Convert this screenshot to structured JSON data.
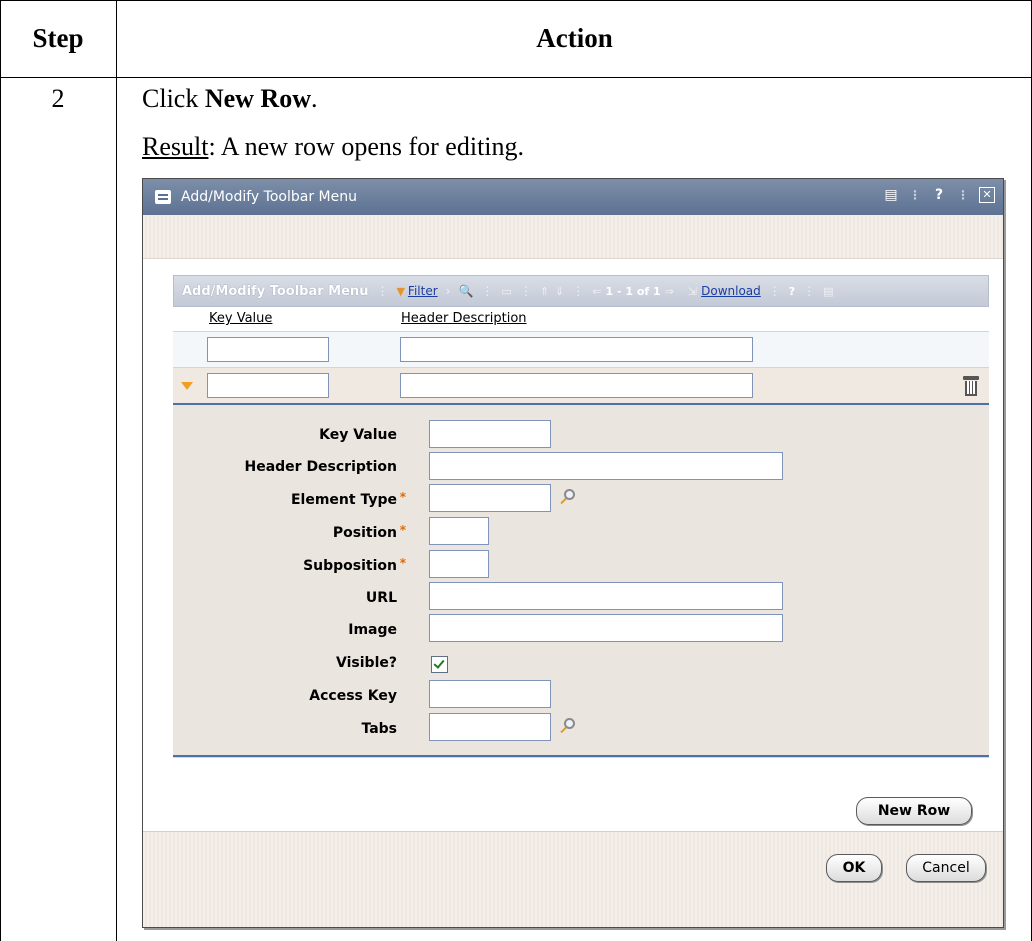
{
  "doc": {
    "header_step": "Step",
    "header_action": "Action",
    "step_number": "2",
    "instruction_prefix": "Click ",
    "instruction_bold": "New Row",
    "instruction_suffix": ".",
    "result_label": "Result",
    "result_text": ": A new row opens for editing."
  },
  "dialog": {
    "title": "Add/Modify Toolbar Menu",
    "title_controls": [
      "window-icon",
      "help-icon",
      "close-icon"
    ],
    "help_glyph": "?",
    "grid": {
      "title": "Add/Modify Toolbar Menu",
      "filter_label": "Filter",
      "pagination": "1 - 1 of 1",
      "download_label": "Download",
      "help_glyph": "?",
      "columns": [
        "Key Value",
        "Header Description"
      ],
      "rows": [
        {
          "key_value": "",
          "header_description": "",
          "selected": false
        },
        {
          "key_value": "",
          "header_description": "",
          "selected": true
        }
      ]
    },
    "detail_fields": [
      {
        "label": "Key Value",
        "required": false,
        "value": ""
      },
      {
        "label": "Header Description",
        "required": false,
        "value": ""
      },
      {
        "label": "Element Type",
        "required": true,
        "value": ""
      },
      {
        "label": "Position",
        "required": true,
        "value": ""
      },
      {
        "label": "Subposition",
        "required": true,
        "value": ""
      },
      {
        "label": "URL",
        "required": false,
        "value": ""
      },
      {
        "label": "Image",
        "required": false,
        "value": ""
      },
      {
        "label": "Visible?",
        "required": false,
        "checked": true
      },
      {
        "label": "Access Key",
        "required": false,
        "value": ""
      },
      {
        "label": "Tabs",
        "required": false,
        "value": ""
      }
    ],
    "required_marker": "*",
    "buttons": {
      "new_row": "New Row",
      "ok": "OK",
      "cancel": "Cancel"
    }
  },
  "colors": {
    "title_bar": "#5d7193",
    "grid_bar": "#c3c9d6",
    "detail_bg": "#ebe5df",
    "required": "#e06b00",
    "link": "#1b3ea0"
  }
}
